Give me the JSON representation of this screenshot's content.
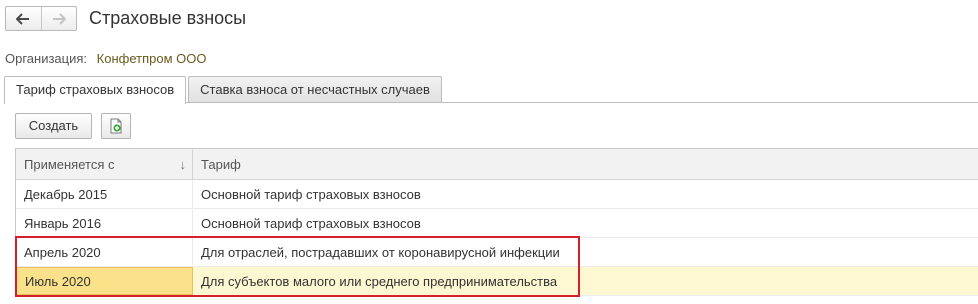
{
  "header": {
    "back_icon": "arrow-left-icon",
    "forward_icon": "arrow-right-icon",
    "title": "Страховые взносы"
  },
  "organization": {
    "label": "Организация:",
    "value": "Конфетпром ООО"
  },
  "tabs": [
    {
      "label": "Тариф страховых взносов",
      "active": true
    },
    {
      "label": "Ставка взноса от несчастных случаев",
      "active": false
    }
  ],
  "toolbar": {
    "create_label": "Создать",
    "copy_icon": "copy-document-icon"
  },
  "table": {
    "columns": [
      "Применяется с",
      "Тариф"
    ],
    "sort_indicator": "↓",
    "rows": [
      {
        "date": "Декабрь 2015",
        "tariff": "Основной тариф страховых взносов",
        "selected": false
      },
      {
        "date": "Январь 2016",
        "tariff": "Основной тариф страховых взносов",
        "selected": false
      },
      {
        "date": "Апрель 2020",
        "tariff": "Для отраслей, пострадавших от коронавирусной инфекции",
        "selected": false
      },
      {
        "date": "Июль 2020",
        "tariff": "Для субъектов малого или среднего предпринимательства",
        "selected": true
      }
    ]
  },
  "colors": {
    "highlight_frame": "#d41f2c",
    "selected_row": "#fdf7d2",
    "selected_cell": "#fbe18a",
    "organization_link": "#6b5a1e"
  }
}
